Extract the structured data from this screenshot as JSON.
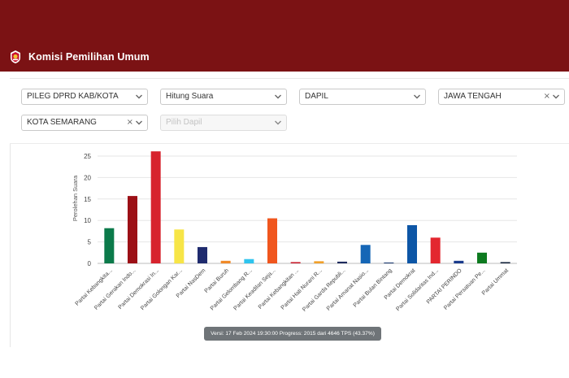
{
  "header": {
    "title": "Komisi Pemilihan Umum",
    "background": "#7b1214",
    "logo": "kpu-emblem-icon"
  },
  "filters": {
    "election_type": "PILEG DPRD KAB/KOTA",
    "mode": "Hitung Suara",
    "dapil_level": "DAPIL",
    "province": "JAWA TENGAH",
    "city": "KOTA SEMARANG",
    "dapil_placeholder": "Pilih Dapil"
  },
  "chart_data": {
    "type": "bar",
    "ylabel": "Perolehan Suara",
    "ylim": [
      0,
      25
    ],
    "yticks": [
      0,
      5,
      10,
      15,
      20,
      25
    ],
    "grid": true,
    "categories": [
      "Partai Kebangkita...",
      "Partai Gerakan Indo...",
      "Partai Demokrasi In...",
      "Partai Golongan Kar...",
      "Partai NasDem",
      "Partai Buruh",
      "Partai Gelombang R...",
      "Partai Keadilan Seja...",
      "Partai Kebangkitan ...",
      "Partai Hati Nurani R...",
      "Partai Garda Republi...",
      "Partai Amanat Nasio...",
      "Partai Bulan Bintang",
      "Partai Demokrat",
      "Partai Solidaritas Ind...",
      "PARTAI PERINDO",
      "Partai Persatuan Pe...",
      "Partai Ummat"
    ],
    "values": [
      8.2,
      15.7,
      26.1,
      7.9,
      3.8,
      0.6,
      1.0,
      10.5,
      0.3,
      0.5,
      0.4,
      4.3,
      0.2,
      8.9,
      6.0,
      0.6,
      2.5,
      0.3
    ],
    "colors": [
      "#0b7a4a",
      "#9c1016",
      "#d7232d",
      "#f7e547",
      "#1f2b6e",
      "#f08a28",
      "#2fc4ee",
      "#f0561e",
      "#c81e2e",
      "#f0a02a",
      "#1d2b5e",
      "#1566b6",
      "#16356e",
      "#0d56a6",
      "#e3272f",
      "#1a3b8c",
      "#0d7a1f",
      "#17263f"
    ]
  },
  "tooltip": "Versi: 17 Feb 2024 19:30:00 Progress: 2015 dari 4646 TPS (43.37%)"
}
